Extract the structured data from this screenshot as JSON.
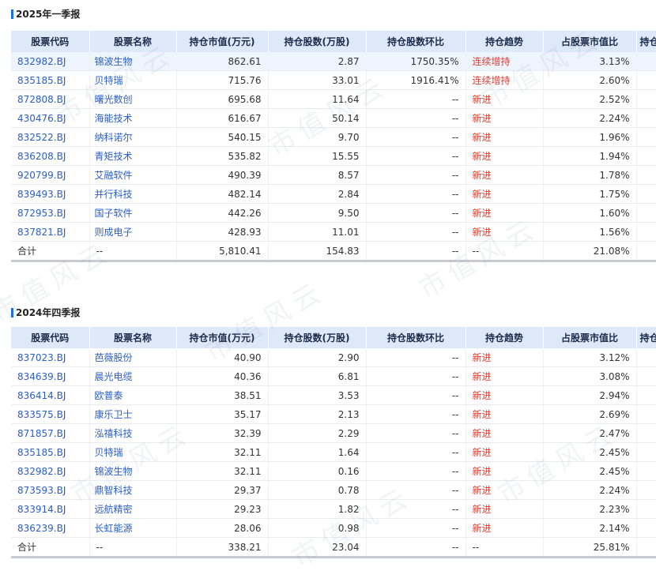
{
  "watermark": "市值风云",
  "columns": [
    "股票代码",
    "股票名称",
    "持仓市值(万元)",
    "持仓股数(万股)",
    "持仓股数环比",
    "持仓趋势",
    "占股票市值比",
    "持仓"
  ],
  "sections": [
    {
      "title": "2025年一季报",
      "rows": [
        {
          "code": "832982.BJ",
          "name": "锦波生物",
          "value": "862.61",
          "shares": "2.87",
          "qoq": "1750.35%",
          "trend": "连续增持",
          "ratio": "3.13%",
          "highlight": true
        },
        {
          "code": "835185.BJ",
          "name": "贝特瑞",
          "value": "715.76",
          "shares": "33.01",
          "qoq": "1916.41%",
          "trend": "连续增持",
          "ratio": "2.60%"
        },
        {
          "code": "872808.BJ",
          "name": "曙光数创",
          "value": "695.68",
          "shares": "11.64",
          "qoq": "--",
          "trend": "新进",
          "ratio": "2.52%"
        },
        {
          "code": "430476.BJ",
          "name": "海能技术",
          "value": "616.67",
          "shares": "50.14",
          "qoq": "--",
          "trend": "新进",
          "ratio": "2.24%"
        },
        {
          "code": "832522.BJ",
          "name": "纳科诺尔",
          "value": "540.15",
          "shares": "9.70",
          "qoq": "--",
          "trend": "新进",
          "ratio": "1.96%"
        },
        {
          "code": "836208.BJ",
          "name": "青矩技术",
          "value": "535.82",
          "shares": "15.55",
          "qoq": "--",
          "trend": "新进",
          "ratio": "1.94%"
        },
        {
          "code": "920799.BJ",
          "name": "艾融软件",
          "value": "490.39",
          "shares": "8.57",
          "qoq": "--",
          "trend": "新进",
          "ratio": "1.78%"
        },
        {
          "code": "839493.BJ",
          "name": "并行科技",
          "value": "482.14",
          "shares": "2.84",
          "qoq": "--",
          "trend": "新进",
          "ratio": "1.75%"
        },
        {
          "code": "872953.BJ",
          "name": "国子软件",
          "value": "442.26",
          "shares": "9.50",
          "qoq": "--",
          "trend": "新进",
          "ratio": "1.60%"
        },
        {
          "code": "837821.BJ",
          "name": "则成电子",
          "value": "428.93",
          "shares": "11.01",
          "qoq": "--",
          "trend": "新进",
          "ratio": "1.56%"
        }
      ],
      "total": {
        "label": "合计",
        "name": "--",
        "value": "5,810.41",
        "shares": "154.83",
        "qoq": "--",
        "trend": "--",
        "ratio": "21.08%"
      }
    },
    {
      "title": "2024年四季报",
      "rows": [
        {
          "code": "837023.BJ",
          "name": "芭薇股份",
          "value": "40.90",
          "shares": "2.90",
          "qoq": "--",
          "trend": "新进",
          "ratio": "3.12%"
        },
        {
          "code": "834639.BJ",
          "name": "晨光电缆",
          "value": "40.36",
          "shares": "6.81",
          "qoq": "--",
          "trend": "新进",
          "ratio": "3.08%"
        },
        {
          "code": "836414.BJ",
          "name": "欧普泰",
          "value": "38.51",
          "shares": "3.53",
          "qoq": "--",
          "trend": "新进",
          "ratio": "2.94%"
        },
        {
          "code": "833575.BJ",
          "name": "康乐卫士",
          "value": "35.17",
          "shares": "2.13",
          "qoq": "--",
          "trend": "新进",
          "ratio": "2.69%"
        },
        {
          "code": "871857.BJ",
          "name": "泓禧科技",
          "value": "32.39",
          "shares": "2.29",
          "qoq": "--",
          "trend": "新进",
          "ratio": "2.47%"
        },
        {
          "code": "835185.BJ",
          "name": "贝特瑞",
          "value": "32.11",
          "shares": "1.64",
          "qoq": "--",
          "trend": "新进",
          "ratio": "2.45%"
        },
        {
          "code": "832982.BJ",
          "name": "锦波生物",
          "value": "32.11",
          "shares": "0.16",
          "qoq": "--",
          "trend": "新进",
          "ratio": "2.45%"
        },
        {
          "code": "873593.BJ",
          "name": "鼎智科技",
          "value": "29.37",
          "shares": "0.78",
          "qoq": "--",
          "trend": "新进",
          "ratio": "2.24%"
        },
        {
          "code": "833914.BJ",
          "name": "远航精密",
          "value": "29.23",
          "shares": "1.82",
          "qoq": "--",
          "trend": "新进",
          "ratio": "2.23%"
        },
        {
          "code": "836239.BJ",
          "name": "长虹能源",
          "value": "28.06",
          "shares": "0.98",
          "qoq": "--",
          "trend": "新进",
          "ratio": "2.14%"
        }
      ],
      "total": {
        "label": "合计",
        "name": "--",
        "value": "338.21",
        "shares": "23.04",
        "qoq": "--",
        "trend": "--",
        "ratio": "25.81%"
      }
    }
  ]
}
